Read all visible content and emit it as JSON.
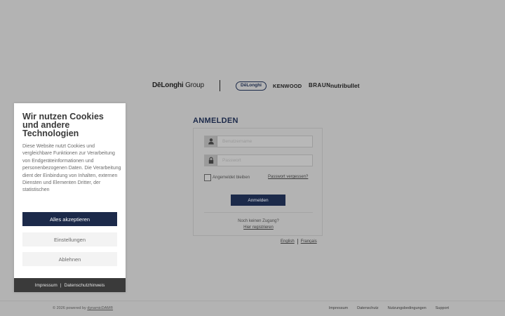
{
  "brands": {
    "group_bold": "DēLonghi",
    "group_light": " Group",
    "delonghi": "DēLonghi",
    "kenwood": "KENWOOD",
    "braun": "BRAUN",
    "nutribullet": "nutribullet"
  },
  "login": {
    "title": "ANMELDEN",
    "username_placeholder": "Benutzername",
    "password_placeholder": "Passwort",
    "remember_label": "Angemeldet bleiben",
    "forgot_link": "Passwort vergessen?",
    "submit_label": "Anmelden",
    "no_account_text": "Noch keinen Zugang?",
    "register_link": "Hier registrieren"
  },
  "languages": [
    "English",
    "Français"
  ],
  "footer": {
    "copyright_prefix": "© 2026 powered by ",
    "copyright_link": "dynamicDAM®",
    "links": [
      "Impressum",
      "Datenschutz",
      "Nutzungsbedingungen",
      "Support"
    ]
  },
  "cookie": {
    "title": "Wir nutzen Cookies und andere Technologien",
    "text": "Diese Website nutzt Cookies und vergleichbare Funktionen zur Verarbeitung von Endgeräteinformationen und personenbezogenen Daten. Die Verarbeitung dient der Einbindung von Inhalten, externen Diensten und Elementen Dritter, der statistischen",
    "accept_label": "Alles akzeptieren",
    "settings_label": "Einstellungen",
    "decline_label": "Ablehnen",
    "footer_impressum": "Impressum",
    "footer_separator": "|",
    "footer_privacy": "Datenschutzhinweis"
  },
  "colors": {
    "overlay_background": "#b3b3b3",
    "brand_navy": "#1c2a4a",
    "cookie_footer": "#3a3a3a"
  },
  "icons": {
    "username": "user-icon",
    "password": "lock-icon"
  }
}
